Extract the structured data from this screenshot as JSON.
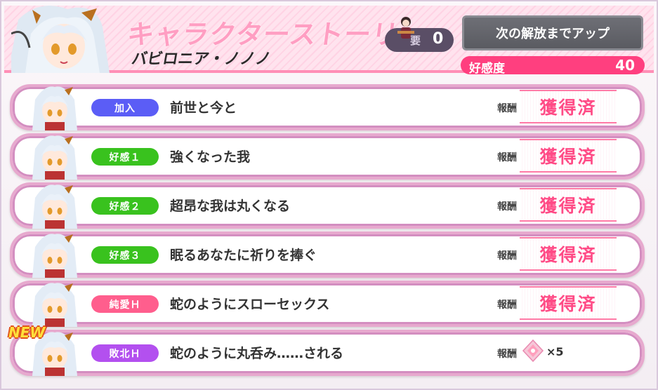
{
  "header": {
    "title": "キャラクターストーリー",
    "character_name": "バビロニア・ノノノ",
    "requirement_label": "要",
    "requirement_value": "0",
    "unlock_button": "次の解放までアップ",
    "affinity_label": "好感度",
    "affinity_value": "40"
  },
  "colors": {
    "blue": "#5b5df6",
    "green": "#39c21e",
    "pink": "#ff5e8d",
    "purple": "#b350ef"
  },
  "stories": [
    {
      "tag": "加入",
      "tag_color": "blue",
      "title": "前世と今と",
      "reward_label": "報酬",
      "reward": "獲得済",
      "is_new": false
    },
    {
      "tag": "好感１",
      "tag_color": "green",
      "title": "強くなった我",
      "reward_label": "報酬",
      "reward": "獲得済",
      "is_new": false
    },
    {
      "tag": "好感２",
      "tag_color": "green",
      "title": "超昂な我は丸くなる",
      "reward_label": "報酬",
      "reward": "獲得済",
      "is_new": false
    },
    {
      "tag": "好感３",
      "tag_color": "green",
      "title": "眠るあなたに祈りを捧ぐ",
      "reward_label": "報酬",
      "reward": "獲得済",
      "is_new": false
    },
    {
      "tag": "純愛Ｈ",
      "tag_color": "pink",
      "title": "蛇のようにスローセックス",
      "reward_label": "報酬",
      "reward": "獲得済",
      "is_new": false
    },
    {
      "tag": "敗北Ｈ",
      "tag_color": "purple",
      "title": "蛇のように丸呑み……される",
      "reward_label": "報酬",
      "reward_count": "×5",
      "reward_icon": "crystal-icon",
      "new_label": "NEW",
      "is_new": true
    }
  ]
}
